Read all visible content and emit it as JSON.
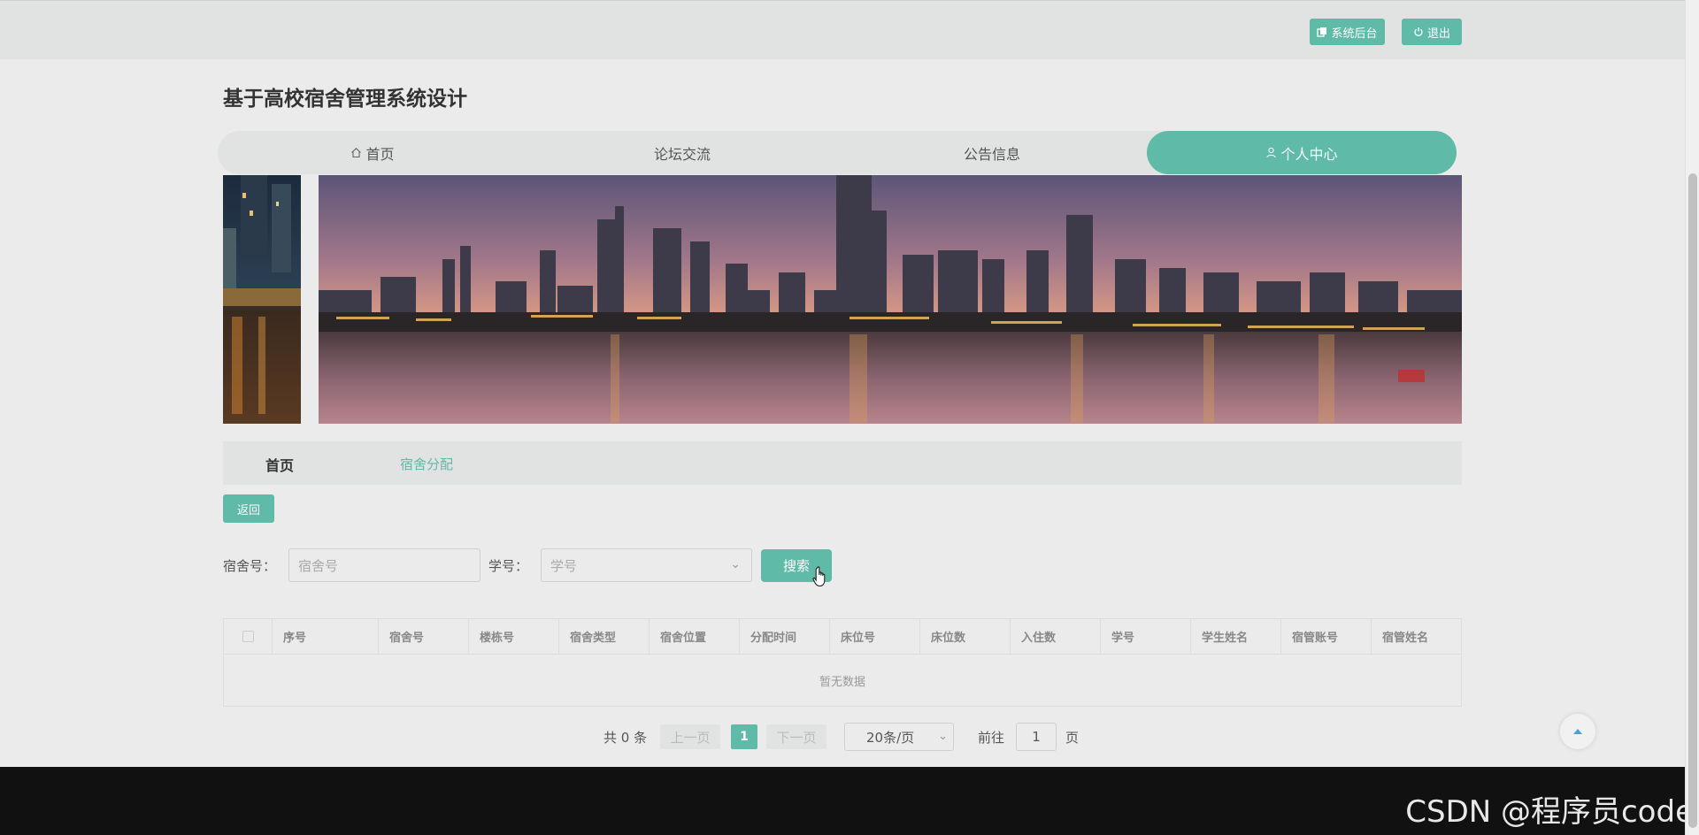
{
  "colors": {
    "accent": "#5fbaa7",
    "nav_bg": "#e1e3e3",
    "page_bg": "#ebebeb",
    "footer_bg": "#111111"
  },
  "topbar": {
    "admin_label": "系统后台",
    "admin_icon": "copy-icon",
    "logout_label": "退出",
    "logout_icon": "power-icon"
  },
  "site_title": "基于高校宿舍管理系统设计",
  "nav": {
    "items": [
      {
        "label": "首页",
        "icon": "home-icon",
        "active": false
      },
      {
        "label": "论坛交流",
        "active": false
      },
      {
        "label": "公告信息",
        "active": false
      },
      {
        "label": "个人中心",
        "icon": "user-icon",
        "active": true
      }
    ]
  },
  "subnav": {
    "home": "首页",
    "current": "宿舍分配"
  },
  "back_label": "返回",
  "search": {
    "dorm_label": "宿舍号：",
    "dorm_placeholder": "宿舍号",
    "student_label": "学号：",
    "student_placeholder": "学号",
    "button_label": "搜索"
  },
  "table": {
    "columns": [
      "序号",
      "宿舍号",
      "楼栋号",
      "宿舍类型",
      "宿舍位置",
      "分配时间",
      "床位号",
      "床位数",
      "入住数",
      "学号",
      "学生姓名",
      "宿管账号",
      "宿管姓名"
    ],
    "empty_text": "暂无数据"
  },
  "pagination": {
    "total": "共 0 条",
    "prev": "上一页",
    "page": "1",
    "next": "下一页",
    "page_size": "20条/页",
    "goto_label": "前往",
    "goto_value": "1",
    "unit": "页"
  },
  "watermark": "CSDN @程序员code"
}
